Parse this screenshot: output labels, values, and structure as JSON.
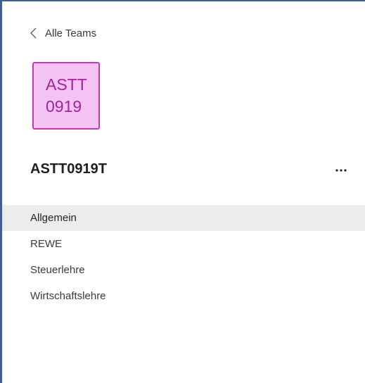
{
  "navigation": {
    "back_label": "Alle Teams"
  },
  "team": {
    "avatar_line1": "ASTT",
    "avatar_line2": "0919",
    "avatar_border_color": "#c239b3",
    "avatar_fill_color": "#f5c3f3",
    "avatar_text_color": "#a2239c",
    "name": "ASTT0919T",
    "more_icon": "more-options-ellipsis"
  },
  "channels": [
    {
      "label": "Allgemein",
      "selected": true
    },
    {
      "label": "REWE",
      "selected": false
    },
    {
      "label": "Steuerlehre",
      "selected": false
    },
    {
      "label": "Wirtschaftslehre",
      "selected": false
    }
  ]
}
